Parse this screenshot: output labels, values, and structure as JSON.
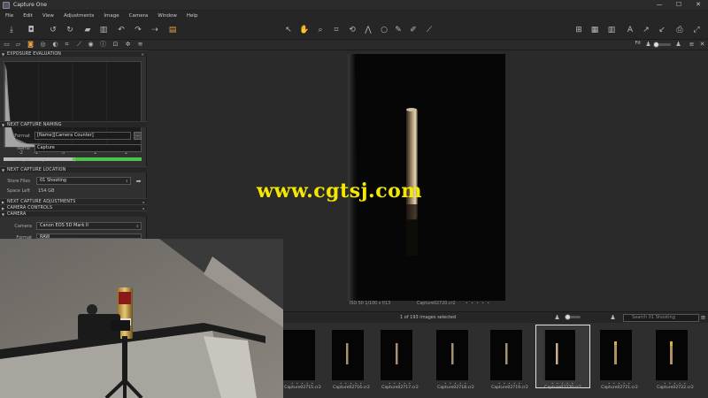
{
  "window": {
    "title": "Capture One",
    "minimize": "—",
    "maximize": "☐",
    "close": "✕"
  },
  "menu": [
    "File",
    "Edit",
    "View",
    "Adjustments",
    "Image",
    "Camera",
    "Window",
    "Help"
  ],
  "viewer": {
    "fit_label": "Fit"
  },
  "panels": {
    "exposure": {
      "title": "EXPOSURE EVALUATION",
      "scale": [
        "-2",
        "-1",
        "0",
        "1",
        "2"
      ]
    },
    "naming": {
      "title": "NEXT CAPTURE NAMING",
      "format_label": "Format",
      "format_value": "[Name][Camera Counter]",
      "more_btn": "...",
      "name_label": "Name",
      "name_value": "Capture",
      "sample_label": "Sample",
      "sample_value": "Capture12345.IIQ"
    },
    "location": {
      "title": "NEXT CAPTURE LOCATION",
      "store_label": "Store Files",
      "store_value": "01 Shooting",
      "space_label": "Space Left",
      "space_value": "154 GB"
    },
    "adjustments": {
      "title": "NEXT CAPTURE ADJUSTMENTS"
    },
    "controls": {
      "title": "CAMERA CONTROLS"
    },
    "camera": {
      "title": "CAMERA",
      "camera_label": "Camera",
      "camera_value": "Canon EOS 5D Mark II",
      "format_label": "Format",
      "format_value": "RAW"
    }
  },
  "photo": {
    "info": "ISO 50  1/100 s  f/13",
    "filename": "Capture02720.cr2",
    "dots": "• • • • •"
  },
  "browser": {
    "selected_text": "1 of 193 images selected",
    "search_placeholder": "Search 01 Shooting",
    "thumbs": [
      {
        "name": "Capture02715.cr2",
        "stars": "• • • • •"
      },
      {
        "name": "Capture02716.cr2",
        "stars": "• • • • •"
      },
      {
        "name": "Capture02717.cr2",
        "stars": "• • • • •"
      },
      {
        "name": "Capture02718.cr2",
        "stars": "• • • • •"
      },
      {
        "name": "Capture02719.cr2",
        "stars": "• • • • •"
      },
      {
        "name": "Capture02720.cr2",
        "stars": "• • • • •"
      },
      {
        "name": "Capture02721.cr2",
        "stars": "• • • • •"
      },
      {
        "name": "Capture02722.cr2",
        "stars": "• • • • •"
      }
    ]
  },
  "watermark": "www.cgtsj.com",
  "colors": {
    "accent": "#e8a040",
    "watermark": "#f4e800",
    "ev_green": "#4cc24c"
  },
  "icons": {
    "toolbar_left": [
      "import-icon",
      "capture-icon",
      "rotate-left-icon",
      "rotate-right-icon",
      "folder-icon",
      "trash-icon",
      "undo-icon",
      "redo-icon",
      "copy-icon",
      "stack-icon"
    ],
    "toolbar_center": [
      "select-icon",
      "pan-icon",
      "loupe-icon",
      "crop-icon",
      "straighten-icon",
      "keystone-icon",
      "spot-icon",
      "brush-icon",
      "eraser-icon",
      "picker-icon"
    ],
    "toolbar_right": [
      "grid-icon",
      "grid-alt-icon",
      "columns-icon",
      "text-icon",
      "arrow-up-icon",
      "arrow-down-icon",
      "print-icon",
      "expand-icon"
    ]
  }
}
